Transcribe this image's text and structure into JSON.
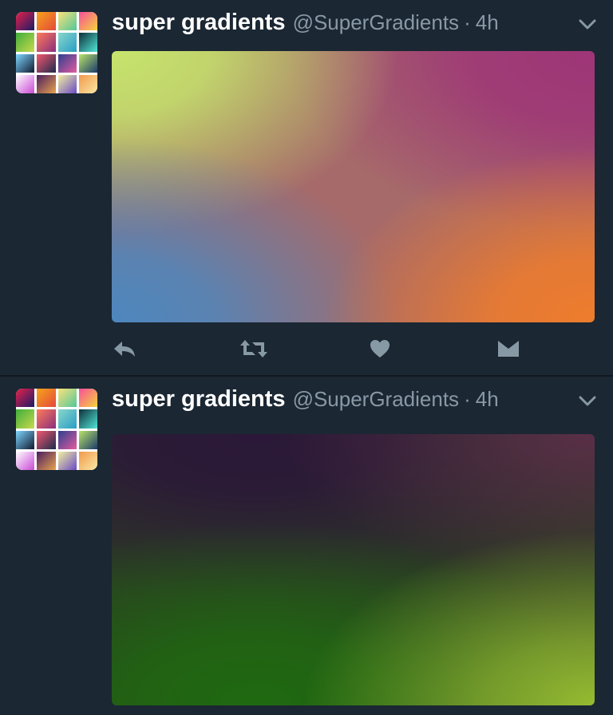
{
  "tweets": [
    {
      "author_name": "super gradients",
      "handle": "@SuperGradients",
      "separator": "·",
      "time": "4h",
      "media": {
        "type": "gradient-image",
        "colors": {
          "top_left": "#c6e56c",
          "top_right": "#9e3577",
          "bottom_left": "#4d87be",
          "bottom_right": "#ee7c2c"
        }
      },
      "actions": [
        {
          "name": "reply",
          "icon": "reply-icon"
        },
        {
          "name": "retweet",
          "icon": "retweet-icon"
        },
        {
          "name": "like",
          "icon": "heart-icon"
        },
        {
          "name": "direct-message",
          "icon": "envelope-icon"
        }
      ]
    },
    {
      "author_name": "super gradients",
      "handle": "@SuperGradients",
      "separator": "·",
      "time": "4h",
      "media": {
        "type": "gradient-image",
        "colors": {
          "top_left": "#2b1838",
          "top_right": "#5a2f47",
          "bottom_left": "#1f6a10",
          "bottom_right": "#95bc31"
        }
      }
    }
  ],
  "theme": {
    "background": "#1b2733",
    "name_color": "#ffffff",
    "meta_color": "#8899a6",
    "icon_color": "#8899a6"
  }
}
